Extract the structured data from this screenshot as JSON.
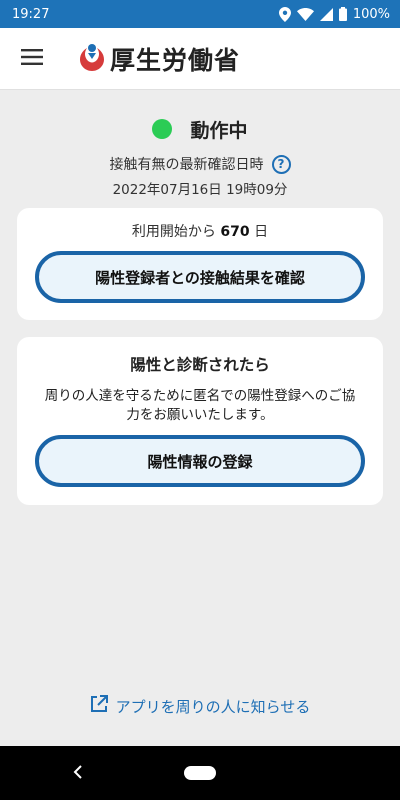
{
  "status_bar": {
    "time": "19:27",
    "battery": "100%"
  },
  "app_bar": {
    "logo_text": "厚生労働省"
  },
  "status": {
    "active_label": "動作中",
    "confirm_label": "接触有無の最新確認日時",
    "help_symbol": "?",
    "confirm_datetime": "2022年07月16日 19時09分"
  },
  "card1": {
    "usage_prefix": "利用開始から",
    "usage_days": "670",
    "usage_suffix": "日",
    "button_label": "陽性登録者との接触結果を確認"
  },
  "card2": {
    "title": "陽性と診断されたら",
    "body": "周りの人達を守るために匿名での陽性登録へのご協力をお願いいたします。",
    "button_label": "陽性情報の登録"
  },
  "share": {
    "label": "アプリを周りの人に知らせる"
  },
  "colors": {
    "status_bar": "#1e73b8",
    "accent": "#1a64a7",
    "active_dot": "#2bcc55",
    "background": "#ededed"
  }
}
